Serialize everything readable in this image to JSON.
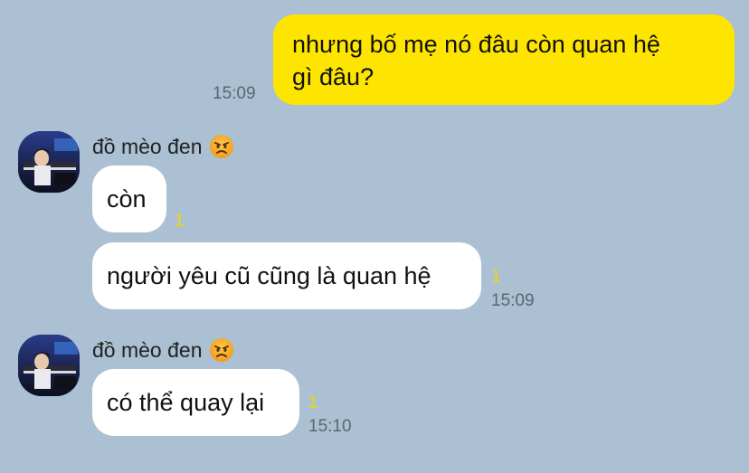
{
  "messages": [
    {
      "direction": "outgoing",
      "lines": [
        "nhưng bố mẹ nó đâu còn quan hệ",
        "gì đâu?"
      ],
      "time": "15:09"
    },
    {
      "direction": "incoming",
      "sender": "đồ mèo đen",
      "sender_emoji": "angry-face-emoji",
      "bubbles": [
        {
          "text": "còn",
          "unread": "1"
        },
        {
          "text": "người yêu cũ cũng là quan hệ",
          "unread": "1",
          "time": "15:09"
        }
      ]
    },
    {
      "direction": "incoming",
      "sender": "đồ mèo đen",
      "sender_emoji": "angry-face-emoji",
      "bubbles": [
        {
          "text": "có thể quay lại",
          "unread": "1",
          "time": "15:10"
        }
      ]
    }
  ],
  "colors": {
    "background": "#abc0d3",
    "outgoing_bubble": "#fee500",
    "incoming_bubble": "#ffffff",
    "unread_count": "#f2d700",
    "timestamp": "#5b6670"
  }
}
